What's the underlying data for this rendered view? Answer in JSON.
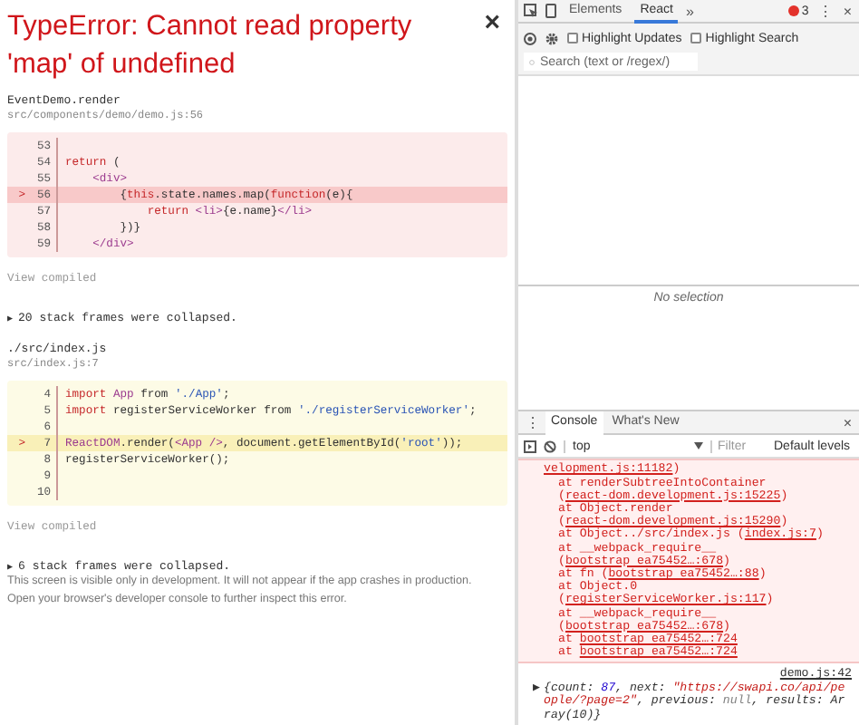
{
  "error_overlay": {
    "title": "TypeError: Cannot read property 'map' of undefined",
    "close": "×",
    "frames": [
      {
        "kind": "error_frame",
        "function": "EventDemo.render",
        "location": "src/components/demo/demo.js:56",
        "view_compiled": "View compiled",
        "lines": [
          {
            "number": "53",
            "highlighted": false
          },
          {
            "number": "54",
            "highlighted": false,
            "tokens": [
              {
                "kind": "kw",
                "text": "return"
              },
              {
                "kind": "plain",
                "text": " ("
              }
            ]
          },
          {
            "number": "55",
            "highlighted": false,
            "tokens": [
              {
                "kind": "tag",
                "text": "    <div>"
              }
            ]
          },
          {
            "number": "56",
            "highlighted": true,
            "marker": ">",
            "tokens": [
              {
                "kind": "plain",
                "text": "        {"
              },
              {
                "kind": "kw",
                "text": "this"
              },
              {
                "kind": "plain",
                "text": ".state.names.map("
              },
              {
                "kind": "kw",
                "text": "function"
              },
              {
                "kind": "plain",
                "text": "(e){"
              }
            ]
          },
          {
            "number": "57",
            "highlighted": false,
            "tokens": [
              {
                "kind": "kw",
                "text": "            return"
              },
              {
                "kind": "tag",
                "text": " <li>"
              },
              {
                "kind": "plain",
                "text": "{e.name}"
              },
              {
                "kind": "tag",
                "text": "</li>"
              }
            ]
          },
          {
            "number": "58",
            "highlighted": false,
            "tokens": [
              {
                "kind": "plain",
                "text": "        })}"
              }
            ]
          },
          {
            "number": "59",
            "highlighted": false,
            "tokens": [
              {
                "kind": "tag",
                "text": "    </div>"
              }
            ]
          }
        ]
      },
      {
        "kind": "collapsed",
        "expander": "▶",
        "text": "20 stack frames were collapsed."
      },
      {
        "kind": "app_frame",
        "function": "./src/index.js",
        "location": "src/index.js:7",
        "view_compiled": "View compiled",
        "lines": [
          {
            "number": "4",
            "highlighted": false,
            "tokens": [
              {
                "kind": "kw",
                "text": "import"
              },
              {
                "kind": "tag",
                "text": " App"
              },
              {
                "kind": "plain",
                "text": " from "
              },
              {
                "kind": "str",
                "text": "'./App'"
              },
              {
                "kind": "plain",
                "text": ";"
              }
            ]
          },
          {
            "number": "5",
            "highlighted": false,
            "tokens": [
              {
                "kind": "kw",
                "text": "import"
              },
              {
                "kind": "plain",
                "text": " registerServiceWorker from "
              },
              {
                "kind": "str",
                "text": "'./registerServiceWorker'"
              },
              {
                "kind": "plain",
                "text": ";"
              }
            ]
          },
          {
            "number": "6",
            "highlighted": false
          },
          {
            "number": "7",
            "highlighted": true,
            "marker": ">",
            "tokens": [
              {
                "kind": "tag",
                "text": "ReactDOM"
              },
              {
                "kind": "plain",
                "text": ".render("
              },
              {
                "kind": "tag",
                "text": "<App />"
              },
              {
                "kind": "plain",
                "text": ", document.getElementById("
              },
              {
                "kind": "str",
                "text": "'root'"
              },
              {
                "kind": "plain",
                "text": "));"
              }
            ]
          },
          {
            "number": "8",
            "highlighted": false,
            "tokens": [
              {
                "kind": "plain",
                "text": "registerServiceWorker();"
              }
            ]
          },
          {
            "number": "9",
            "highlighted": false
          },
          {
            "number": "10",
            "highlighted": false
          }
        ]
      },
      {
        "kind": "collapsed",
        "expander": "▶",
        "text": "6 stack frames were collapsed."
      }
    ],
    "footer": [
      "This screen is visible only in development. It will not appear if the app crashes in production.",
      "Open your browser's developer console to further inspect this error."
    ]
  },
  "devtools": {
    "toolbar": {
      "tabs": [
        {
          "label": "Elements",
          "selected": false
        },
        {
          "label": "React",
          "selected": true
        }
      ],
      "overflow": "»",
      "error_count": "3",
      "menu": "⋮",
      "close": "×"
    },
    "react_panel": {
      "options": [
        {
          "label": "Highlight Updates",
          "checked": false
        },
        {
          "label": "Highlight Search",
          "checked": false
        }
      ],
      "search": {
        "placeholder": "Search (text or /regex/)"
      },
      "detail": "No selection"
    },
    "drawer": {
      "menu": "⋮",
      "tabs": [
        {
          "label": "Console",
          "selected": true
        },
        {
          "label": "What's New",
          "selected": false
        }
      ],
      "close": "×",
      "context": "top",
      "filter": {
        "placeholder": "Filter"
      },
      "levels": "Default levels",
      "messages": [
        {
          "kind": "error",
          "lines": [
            {
              "link": "velopment.js:11182",
              "suffix": ")"
            },
            {
              "text": "at renderSubtreeIntoContainer (",
              "link": "react-dom.development.js:15225",
              "suffix": ")"
            },
            {
              "text": "at Object.render (",
              "link": "react-dom.development.js:15290",
              "suffix": ")"
            },
            {
              "text": "at Object../src/index.js (",
              "link": "index.js:7",
              "suffix": ")"
            },
            {
              "text": "at __webpack_require__ (",
              "link": "bootstrap ea75452…:678",
              "suffix": ")"
            },
            {
              "text": "at fn (",
              "link": "bootstrap ea75452…:88",
              "suffix": ")"
            },
            {
              "text": "at Object.0 (",
              "link": "registerServiceWorker.js:117",
              "suffix": ")"
            },
            {
              "text": "at __webpack_require__ (",
              "link": "bootstrap ea75452…:678",
              "suffix": ")"
            },
            {
              "text": "at ",
              "link": "bootstrap ea75452…:724"
            },
            {
              "text": "at ",
              "link": "bootstrap ea75452…:724"
            }
          ]
        },
        {
          "kind": "log",
          "source": "demo.js:42",
          "expander": "▶",
          "parts": [
            {
              "kind": "punct",
              "text": "{count: "
            },
            {
              "kind": "number",
              "text": "87"
            },
            {
              "kind": "punct",
              "text": ", next: "
            },
            {
              "kind": "string",
              "text": "\"https://swapi.co/api/people/?page=2\""
            },
            {
              "kind": "punct",
              "text": ", previous: "
            },
            {
              "kind": "null",
              "text": "null"
            },
            {
              "kind": "punct",
              "text": ", results: Array(10)}"
            }
          ]
        }
      ]
    }
  }
}
